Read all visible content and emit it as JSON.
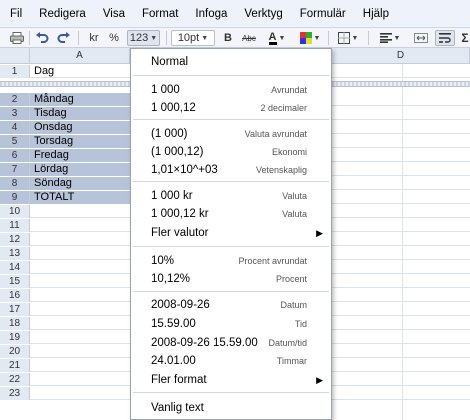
{
  "menubar": {
    "items": [
      "Fil",
      "Redigera",
      "Visa",
      "Format",
      "Infoga",
      "Verktyg",
      "Formulär",
      "Hjälp"
    ]
  },
  "toolbar": {
    "currency": "kr",
    "percent": "%",
    "format_btn": "123",
    "font_size": "10pt",
    "bold": "B",
    "strike": "Abc",
    "text_color": "A"
  },
  "columns": [
    "A",
    "D"
  ],
  "rows": [
    {
      "n": "1",
      "v": "Dag"
    },
    {
      "n": "2",
      "v": "Måndag"
    },
    {
      "n": "3",
      "v": "Tisdag"
    },
    {
      "n": "4",
      "v": "Onsdag"
    },
    {
      "n": "5",
      "v": "Torsdag"
    },
    {
      "n": "6",
      "v": "Fredag"
    },
    {
      "n": "7",
      "v": "Lördag"
    },
    {
      "n": "8",
      "v": "Söndag"
    },
    {
      "n": "9",
      "v": "TOTALT"
    },
    {
      "n": "10",
      "v": ""
    },
    {
      "n": "11",
      "v": ""
    },
    {
      "n": "12",
      "v": ""
    },
    {
      "n": "13",
      "v": ""
    },
    {
      "n": "14",
      "v": ""
    },
    {
      "n": "15",
      "v": ""
    },
    {
      "n": "16",
      "v": ""
    },
    {
      "n": "17",
      "v": ""
    },
    {
      "n": "18",
      "v": ""
    },
    {
      "n": "19",
      "v": ""
    },
    {
      "n": "20",
      "v": ""
    },
    {
      "n": "21",
      "v": ""
    },
    {
      "n": "22",
      "v": ""
    },
    {
      "n": "23",
      "v": ""
    }
  ],
  "format_menu": {
    "normal": "Normal",
    "items": [
      {
        "label": "1 000",
        "desc": "Avrundat"
      },
      {
        "label": "1 000,12",
        "desc": "2 decimaler"
      },
      {
        "label": "(1 000)",
        "desc": "Valuta avrundat"
      },
      {
        "label": "(1 000,12)",
        "desc": "Ekonomi"
      },
      {
        "label": "1,01×10^+03",
        "desc": "Vetenskaplig"
      },
      {
        "label": "1 000 kr",
        "desc": "Valuta"
      },
      {
        "label": "1 000,12 kr",
        "desc": "Valuta"
      },
      {
        "label": "Fler valutor",
        "desc": ""
      },
      {
        "label": "10%",
        "desc": "Procent avrundat"
      },
      {
        "label": "10,12%",
        "desc": "Procent"
      },
      {
        "label": "2008-09-26",
        "desc": "Datum"
      },
      {
        "label": "15.59.00",
        "desc": "Tid"
      },
      {
        "label": "2008-09-26 15.59.00",
        "desc": "Datum/tid"
      },
      {
        "label": "24.01.00",
        "desc": "Timmar"
      },
      {
        "label": "Fler format",
        "desc": ""
      }
    ],
    "plain": "Vanlig text",
    "submenu_arrow": "▶"
  }
}
